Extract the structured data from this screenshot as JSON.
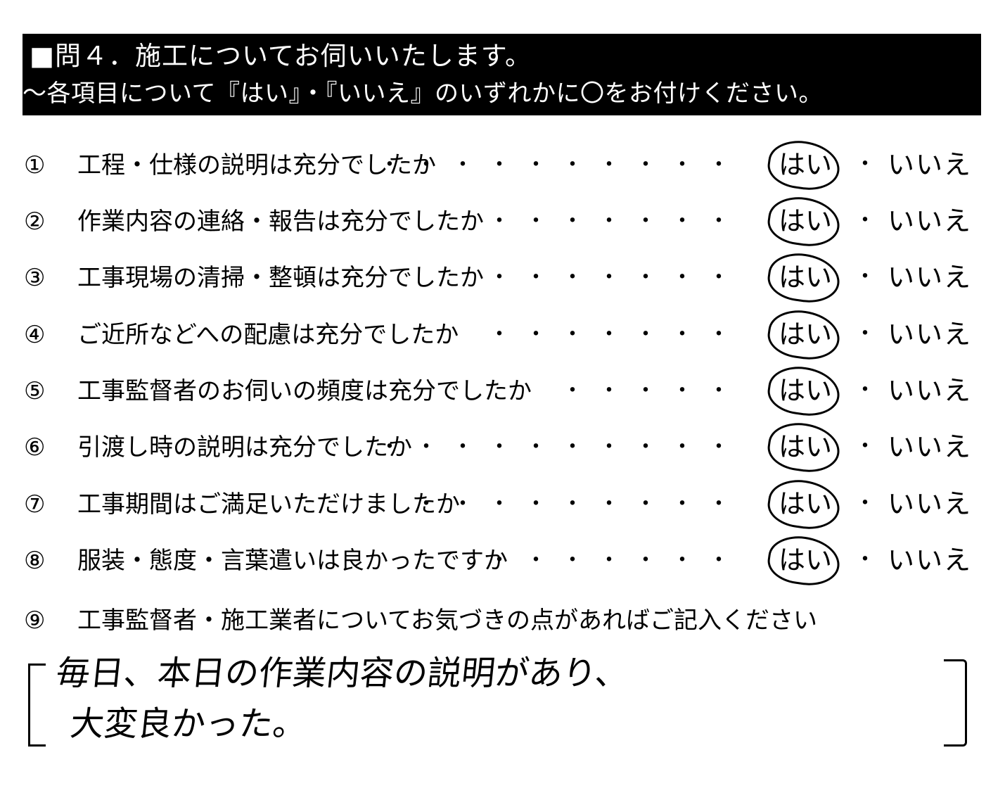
{
  "header": {
    "title": "■問４．施工についてお伺いいたします。",
    "subtitle": "～各項目について『はい』・『いいえ』のいずれかに〇をお付けください。"
  },
  "questions": [
    {
      "num": "①",
      "text": "工程・仕様の説明は充分でしたか",
      "dots": "・・・・・・・・・・",
      "yes": "はい",
      "no": "いいえ",
      "sep": "・",
      "selected": "はい"
    },
    {
      "num": "②",
      "text": "作業内容の連絡・報告は充分でしたか",
      "dots": "・・・・・・・",
      "yes": "はい",
      "no": "いいえ",
      "sep": "・",
      "selected": "はい"
    },
    {
      "num": "③",
      "text": "工事現場の清掃・整頓は充分でしたか",
      "dots": "・・・・・・・",
      "yes": "はい",
      "no": "いいえ",
      "sep": "・",
      "selected": "はい"
    },
    {
      "num": "④",
      "text": "ご近所などへの配慮は充分でしたか",
      "dots": "・・・・・・・",
      "yes": "はい",
      "no": "いいえ",
      "sep": "・",
      "selected": "はい"
    },
    {
      "num": "⑤",
      "text": "工事監督者のお伺いの頻度は充分でしたか",
      "dots": "・・・・・",
      "yes": "はい",
      "no": "いいえ",
      "sep": "・",
      "selected": "はい"
    },
    {
      "num": "⑥",
      "text": "引渡し時の説明は充分でしたか",
      "dots": "・・・・・・・・・・",
      "yes": "はい",
      "no": "いいえ",
      "sep": "・",
      "selected": "はい"
    },
    {
      "num": "⑦",
      "text": "工事期間はご満足いただけましたか",
      "dots": "・・・・・・・・・",
      "yes": "はい",
      "no": "いいえ",
      "sep": "・",
      "selected": "はい"
    },
    {
      "num": "⑧",
      "text": "服装・態度・言葉遣いは良かったですか",
      "dots": "・・・・・・・",
      "yes": "はい",
      "no": "いいえ",
      "sep": "・",
      "selected": "はい"
    }
  ],
  "q9": {
    "num": "⑨",
    "text": "工事監督者・施工業者についてお気づきの点があればご記入ください"
  },
  "answer": {
    "line1": "毎日、本日の作業内容の説明があり、",
    "line2": "大変良かった。"
  }
}
